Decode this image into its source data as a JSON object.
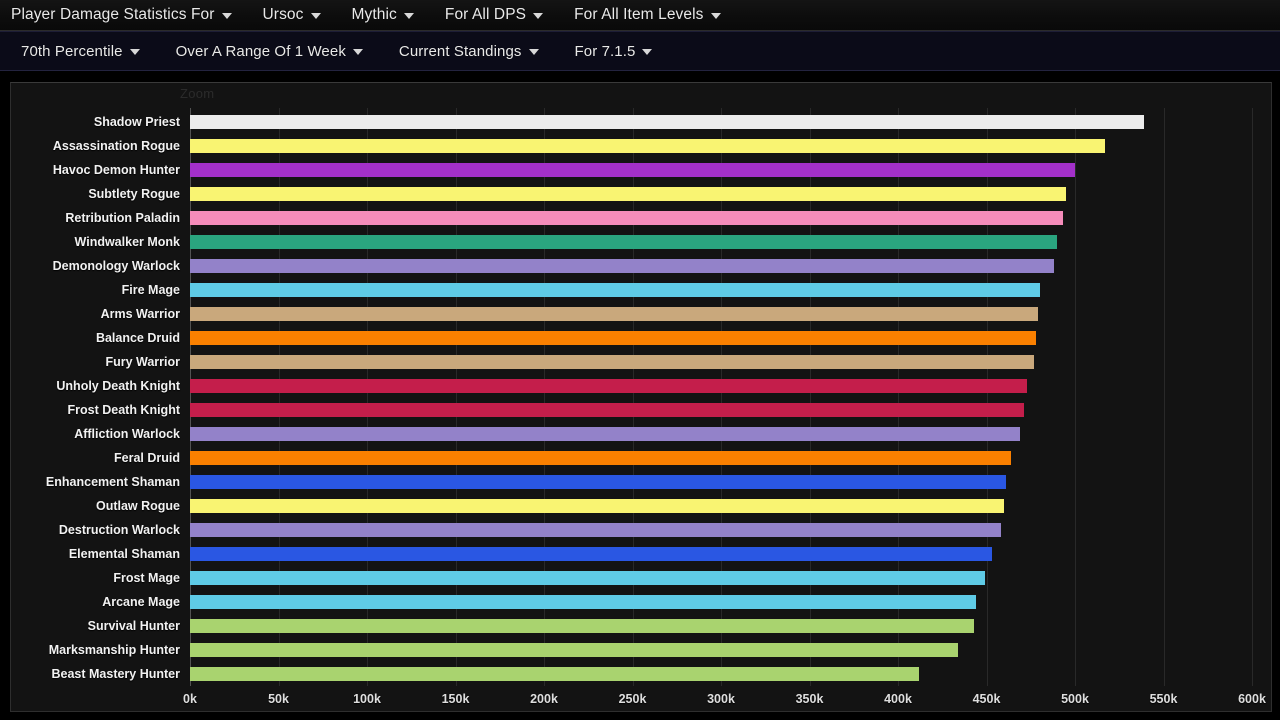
{
  "navbar_primary": {
    "items": [
      {
        "label": "Player Damage Statistics For",
        "caret": "chevron-down-icon"
      },
      {
        "label": "Ursoc",
        "caret": "chevron-down-icon"
      },
      {
        "label": "Mythic",
        "caret": "chevron-down-icon"
      },
      {
        "label": "For All DPS",
        "caret": "chevron-down-icon"
      },
      {
        "label": "For All Item Levels",
        "caret": "chevron-down-icon"
      }
    ]
  },
  "navbar_secondary": {
    "items": [
      {
        "label": "70th Percentile",
        "caret": "chevron-down-icon"
      },
      {
        "label": "Over A Range Of 1 Week",
        "caret": "chevron-down-icon"
      },
      {
        "label": "Current Standings",
        "caret": "chevron-down-icon"
      },
      {
        "label": "For 7.1.5",
        "caret": "chevron-down-icon"
      }
    ]
  },
  "chart_panel": {
    "zoom_label": "Zoom"
  },
  "chart_data": {
    "type": "bar",
    "orientation": "horizontal",
    "title": "Player Damage Statistics For Ursoc",
    "xlabel": "",
    "ylabel": "",
    "xlim": [
      0,
      600000
    ],
    "grid": true,
    "legend": "none",
    "tick_labels": [
      "0k",
      "50k",
      "100k",
      "150k",
      "200k",
      "250k",
      "300k",
      "350k",
      "400k",
      "450k",
      "500k",
      "550k",
      "600k"
    ],
    "tick_values": [
      0,
      50000,
      100000,
      150000,
      200000,
      250000,
      300000,
      350000,
      400000,
      450000,
      500000,
      550000,
      600000
    ],
    "categories": [
      "Shadow Priest",
      "Assassination Rogue",
      "Havoc Demon Hunter",
      "Subtlety Rogue",
      "Retribution Paladin",
      "Windwalker Monk",
      "Demonology Warlock",
      "Fire Mage",
      "Arms Warrior",
      "Balance Druid",
      "Fury Warrior",
      "Unholy Death Knight",
      "Frost Death Knight",
      "Affliction Warlock",
      "Feral Druid",
      "Enhancement Shaman",
      "Outlaw Rogue",
      "Destruction Warlock",
      "Elemental Shaman",
      "Frost Mage",
      "Arcane Mage",
      "Survival Hunter",
      "Marksmanship Hunter",
      "Beast Mastery Hunter"
    ],
    "values": [
      539000,
      517000,
      500000,
      495000,
      493000,
      490000,
      488000,
      480000,
      479000,
      478000,
      477000,
      473000,
      471000,
      469000,
      464000,
      461000,
      460000,
      458000,
      453000,
      449000,
      444000,
      443000,
      434000,
      412000
    ],
    "colors": [
      "#ececec",
      "#f9f472",
      "#a330c9",
      "#f9f472",
      "#f58cba",
      "#2aa57f",
      "#9382c9",
      "#5fcbe6",
      "#c9a87c",
      "#fa8000",
      "#c9a87c",
      "#c41e4b",
      "#c41e4b",
      "#9382c9",
      "#fa8000",
      "#2a57e3",
      "#f9f472",
      "#9382c9",
      "#2a57e3",
      "#5fcbe6",
      "#5fcbe6",
      "#a9d36f",
      "#a9d36f",
      "#a9d36f"
    ]
  }
}
